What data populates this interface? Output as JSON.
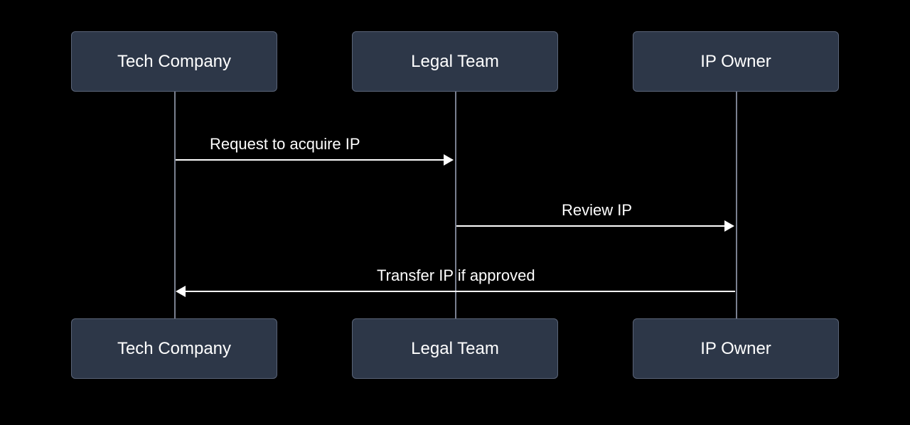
{
  "actors": {
    "tech_company": "Tech Company",
    "legal_team": "Legal Team",
    "ip_owner": "IP Owner"
  },
  "messages": {
    "msg1": "Request to acquire IP",
    "msg2": "Review IP",
    "msg3": "Transfer IP if approved"
  }
}
